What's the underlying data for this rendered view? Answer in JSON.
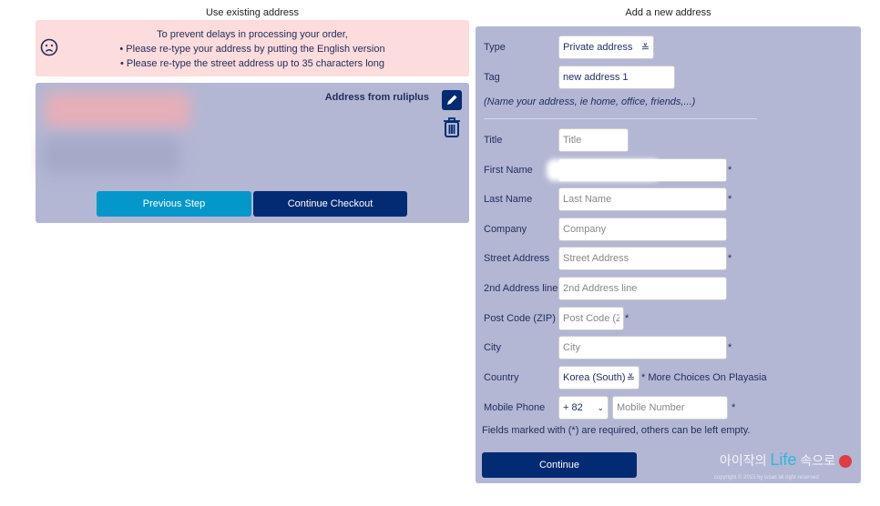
{
  "existing": {
    "heading": "Use existing address",
    "warning": {
      "icon": "sad-face-icon",
      "lines": [
        "To prevent delays in processing your order,",
        "• Please re-type your address by putting the English version",
        "• Please re-type the street address up to 35 characters long"
      ]
    },
    "address_label": "Address from ruliplus",
    "previous_label": "Previous Step",
    "continue_label": "Continue Checkout"
  },
  "new_address": {
    "heading": "Add a new address",
    "type_label": "Type",
    "type_value": "Private address",
    "tag_label": "Tag",
    "tag_value": "new address 1",
    "tag_hint": "(Name your address, ie home, office, friends,...)",
    "title_label": "Title",
    "title_ph": "Title",
    "first_label": "First Name",
    "last_label": "Last Name",
    "last_ph": "Last Name",
    "company_label": "Company",
    "company_ph": "Company",
    "street_label": "Street Address",
    "street_ph": "Street Address",
    "addr2_label": "2nd Address line",
    "addr2_ph": "2nd Address line",
    "zip_label": "Post Code (ZIP)",
    "zip_ph": "Post Code (ZIP)",
    "city_label": "City",
    "city_ph": "City",
    "country_label": "Country",
    "country_value": "Korea (South)",
    "country_note": "* More Choices On Playasia",
    "phone_label": "Mobile Phone",
    "phone_code": "+ 82",
    "phone_ph": "Mobile Number",
    "required_note": "Fields marked with (*) are required, others can be left empty.",
    "continue_label": "Continue",
    "star": "*"
  },
  "watermark": {
    "text": "아이작의 Life 속으로",
    "copyright": "copyright © 2015 by issac all right reserved"
  },
  "colors": {
    "panel": "#b3b7d4",
    "warning": "#fcdcdc",
    "primary": "#032b73",
    "secondary": "#0398c9"
  }
}
